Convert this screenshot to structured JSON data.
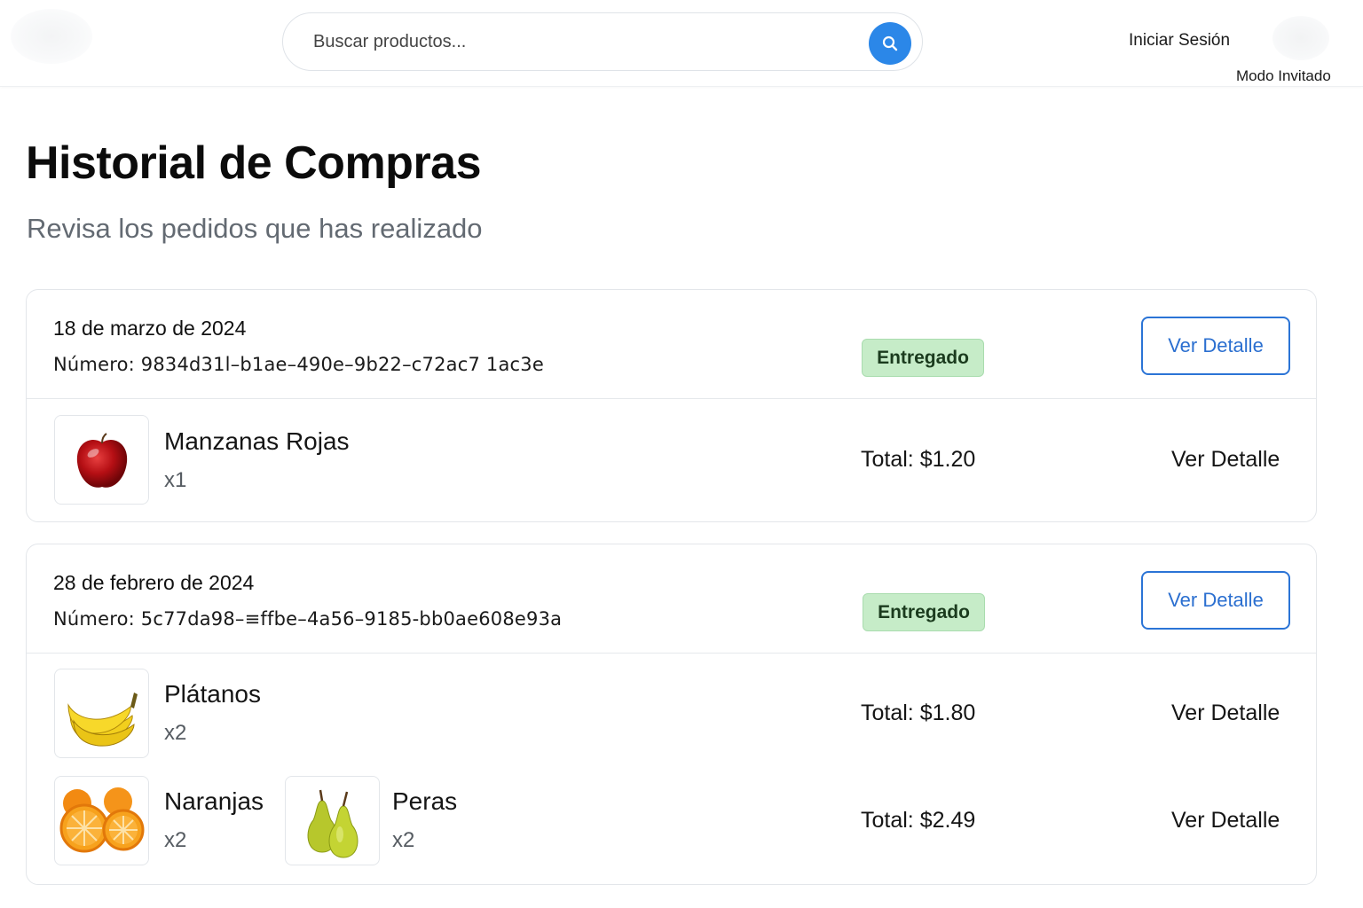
{
  "header": {
    "search_placeholder": "Buscar productos...",
    "login_label": "Iniciar Sesión",
    "guest_mode": "Modo Invitado",
    "accent_color": "#2b87e8"
  },
  "page": {
    "title": "Historial de Compras",
    "subtitle": "Revisa los pedidos que has realizado"
  },
  "orders": [
    {
      "date": "18 de marzo de 2024",
      "number": "Número: 9834d31l–b1ae–490e–9b22–c72ac7 1ac3e",
      "status": "Entregado",
      "detail_button": "Ver Detalle",
      "rows": [
        {
          "items": [
            {
              "name": "Manzanas Rojas",
              "qty": "x1",
              "icon": "red-apple"
            }
          ],
          "total": "Total: $1.20",
          "detail_link": "Ver Detalle"
        }
      ]
    },
    {
      "date": "28 de febrero de 2024",
      "number": "Número: 5c77da98–≡ffbe–4a56–9185-bb0ae608e93a",
      "status": "Entregado",
      "detail_button": "Ver Detalle",
      "rows": [
        {
          "items": [
            {
              "name": "Plátanos",
              "qty": "x2",
              "icon": "bananas"
            }
          ],
          "total": "Total: $1.80",
          "detail_link": "Ver Detalle"
        },
        {
          "items": [
            {
              "name": "Naranjas",
              "qty": "x2",
              "icon": "oranges"
            },
            {
              "name": "Peras",
              "qty": "x2",
              "icon": "pears"
            }
          ],
          "total": "Total: $2.49",
          "detail_link": "Ver Detalle"
        }
      ]
    }
  ]
}
